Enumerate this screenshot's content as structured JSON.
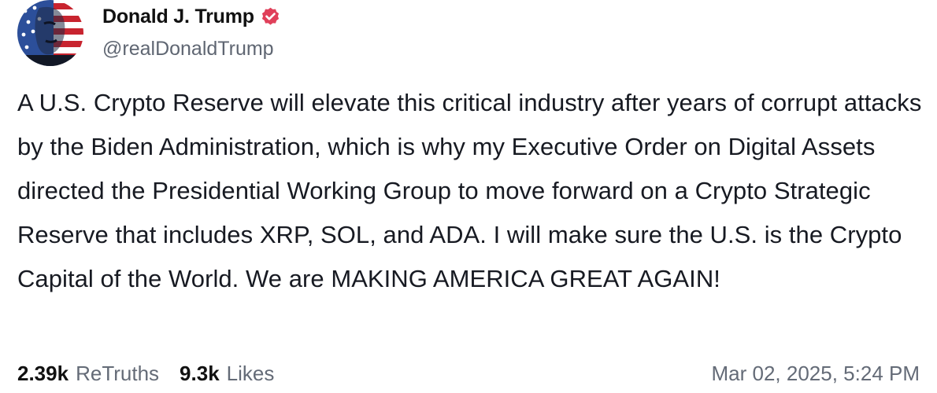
{
  "author": {
    "display_name": "Donald J. Trump",
    "handle": "@realDonaldTrump",
    "verified": true,
    "verified_color": "#e0405a",
    "avatar_icon": "profile-photo-flag-portrait"
  },
  "post": {
    "text": "A U.S. Crypto Reserve will elevate this critical industry after years of corrupt attacks by the Biden Administration, which is why my Executive Order on Digital Assets directed the Presidential Working Group to move forward on a Crypto Strategic Reserve that includes XRP, SOL, and ADA. I will make sure the U.S. is the Crypto Capital of the World. We are MAKING AMERICA GREAT AGAIN!"
  },
  "stats": {
    "retruths_count": "2.39k",
    "retruths_label": "ReTruths",
    "likes_count": "9.3k",
    "likes_label": "Likes"
  },
  "timestamp": "Mar 02, 2025, 5:24 PM"
}
